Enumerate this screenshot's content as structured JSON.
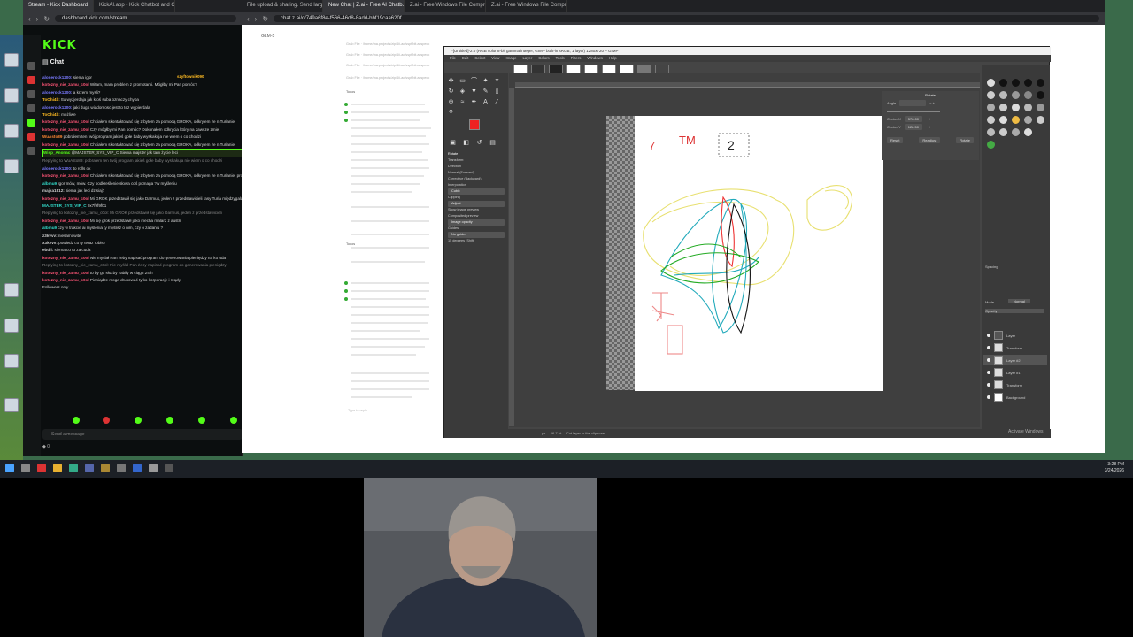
{
  "left_browser": {
    "tabs": [
      "Stream - Kick Dashboard",
      "KickAI.app - Kick Chatbot and Overl..."
    ],
    "url": "dashboard.kick.com/stream",
    "logo": "KICK",
    "chat_title": "Chat",
    "pinned_user": "szyftownik090",
    "chat_lines": [
      {
        "user": "alonerock1200:",
        "text": "siema igor",
        "color": "#7a7aff"
      },
      {
        "user": "kotozny_nie_zamu_c0ol",
        "text": "Witam, mam problem z promptami. Mógłby mi Pan pomóc?",
        "color": "#ff5577"
      },
      {
        "user": "alonerock1200:",
        "text": "a krzem mysli?",
        "color": "#7a7aff"
      },
      {
        "user": "ToOhi4b:",
        "text": "ttu wyzjerdaja jak ktoś suba oznaczy chyba",
        "color": "#ffbb22"
      },
      {
        "user": "alonerock1200:",
        "text": "jaki duga wiadomosc jest to tez wypierdala",
        "color": "#7a7aff"
      },
      {
        "user": "ToOhi4b:",
        "text": "możliwe",
        "color": "#ffbb22"
      },
      {
        "user": "kotozny_nie_zamu_c0ol",
        "text": "Chciałem skontaktować się z bytem za pomocą GROKA, odkryłem że n Turianie",
        "color": "#ff5577"
      },
      {
        "user": "kotozny_nie_zamu_c0ol",
        "text": "Czy mógłby mi Pan pomóc? Dokonałem odkrycia który na zawsze zmie",
        "color": "#ff5577"
      },
      {
        "user": "WuAsto89",
        "text": "pobrałem ten twój program jakieś gołe baby wyskakuja nie wiem o co chodzi",
        "color": "#ff8833"
      },
      {
        "user": "kotozny_nie_zamu_c0ol",
        "text": "Chciałem skontaktować się z bytem za pomocą GROKA, odkryłem że n Turianie",
        "color": "#ff5577"
      },
      {
        "user": "Wisp_Anonac",
        "text": "@MAJSTER_SYS_VIP_C Siema majster jak tam życie leci",
        "color": "#53fc18",
        "highlight": true
      },
      {
        "user": "",
        "text": "Replying to WuAsto89: pobrałem ten twój program jakieś gołe baby wyskakuja nie wiem o co chodzi",
        "color": "#888888",
        "reply": true
      },
      {
        "user": "alonerock1200:",
        "text": "to rolls ok",
        "color": "#7a7aff"
      },
      {
        "user": "kotozny_nie_zamu_c0ol",
        "text": "Chciałem skontaktować się z bytem za pomocą GROKA, odkryłem że n Turianie, proszę Pana to prawdziwe",
        "color": "#ff5577"
      },
      {
        "user": "albmu9",
        "text": "Igor mów, mów. Czy podkreślenie słowa coś pomaga ?w myśleniu",
        "color": "#33ddcc"
      },
      {
        "user": "majka1812:",
        "text": "siema jak leci dzisiaj?",
        "color": "#cccccc"
      },
      {
        "user": "kotozny_nie_zamu_c0ol",
        "text": "Mi GROK przedstawił się jako Darmus, jeden z przedstawicieli rasy Turia międzygalaktycznej. Proszę mi uwierzyć i się go zapytać",
        "color": "#ff5577"
      },
      {
        "user": "MAJSTER_SYS_VIP_C",
        "text": "0x7f9f9f01",
        "color": "#33ddcc"
      },
      {
        "user": "",
        "text": "Replying to kotozny_nie_zamu_c0ol: Mi GROK przedstawił się jako Darmus, jeden z przedstawicieli",
        "color": "#888888",
        "reply": true
      },
      {
        "user": "kotozny_nie_zamu_c0ol",
        "text": "Mi się grok przedstawił jako mecha malarz z austrii",
        "color": "#ff5577"
      },
      {
        "user": "albmu9",
        "text": "czy w trakcie ai myślenia ty myślisz o nim, czy o zadaniu ?",
        "color": "#33ddcc"
      },
      {
        "user": "z3kvvv:",
        "text": "niesamowite",
        "color": "#cccccc"
      },
      {
        "user": "x3kvvv:",
        "text": "powiedz co ty teraz robisz",
        "color": "#cccccc"
      },
      {
        "user": "ebdll:",
        "text": "siema co to za cuda",
        "color": "#cccccc"
      },
      {
        "user": "kotozny_nie_zamu_c0ol",
        "text": "Nie myślał Pan żeby napisać program do generowania pieniędzy na ko uda",
        "color": "#ff5577"
      },
      {
        "user": "",
        "text": "Replying to kotozny_nie_zamu_c0ol: Nie myślał Pan żeby napisać program do generowania pieniędzy",
        "color": "#888888",
        "reply": true
      },
      {
        "user": "kotozny_nie_zamu_c0ol",
        "text": "to by go służby zabiły w ciągu 24 h",
        "color": "#ff5577"
      },
      {
        "user": "kotozny_nie_zamu_c0ol",
        "text": "Pieniądze mogą drukować tylko korporacje i rządy",
        "color": "#ff5577"
      },
      {
        "user": "",
        "text": "Followers only",
        "color": "#aaaaaa"
      }
    ],
    "chat_input_placeholder": "Send a message",
    "chat_points": "0"
  },
  "right_browser": {
    "tabs": [
      "File upload & sharing. Send large ph...",
      "New Chat | Z.ai - Free AI Chatb...",
      "Z.ai - Free Windows File Compre...",
      "Z.ai - Free Windows File Compre..."
    ],
    "url": "chat.z.ai/c/749a6f8e-f566-46d8-8add-bbf19caa620f",
    "app_title": "GLM-5",
    "file_lines": [
      "Grab File · /home/ma.projects/zip/6ii-ac/sspt/bit.acspeck",
      "Grab File · /home/ma.projects/zip/6ii-ac/sspt/bit.acspeck",
      "Grab File · /home/ma.projects/zip/6ii-ac/sspt/bit.acspeck",
      "Grab File · /home/ma.projects/zip/6ii-ac/sspt/bit.acspeck"
    ],
    "todo_label": "Todos",
    "todo_label_2": "Todos",
    "bottom_input": "Type to reply..."
  },
  "gimp": {
    "title": "*[Untitled]-2.0 (RGB color 8-bit gamma integer, GIMP built-in sRGB, 1 layer) 1280x720 – GIMP",
    "menu": [
      "File",
      "Edit",
      "Select",
      "View",
      "Image",
      "Layer",
      "Colors",
      "Tools",
      "Filters",
      "Windows",
      "Help"
    ],
    "tool_options": {
      "title": "Rotate",
      "transform": "Transform:",
      "direction": "Direction",
      "dir_normal": "Normal (Forward)",
      "dir_corrective": "Corrective (Backward)",
      "interpolation": "Interpolation",
      "interpolation_value": "Cubic",
      "clipping": "Clipping",
      "clipping_value": "Adjust",
      "show_preview": "Show image preview",
      "composited_preview": "Composited preview",
      "image_opacity": "Image opacity",
      "guides": "Guides",
      "guides_value": "No guides",
      "angle": "15 degrees (Shift)"
    },
    "rotate_dialog": {
      "title": "Rotate",
      "angle_label": "Angle",
      "center_x_label": "Center X",
      "center_x": "578.00",
      "center_y_label": "Center Y",
      "center_y": "128.50",
      "reset": "Reset",
      "readjust": "Readjust",
      "rotate": "Rotate"
    },
    "canvas_labels": {
      "seven": "7",
      "tm": "TM",
      "two": "2"
    },
    "status": {
      "unit": "px",
      "zoom": "66.7 %",
      "message": "Cut layer to the clipboard."
    },
    "dock": {
      "spacing_label": "Spacing",
      "mode_label": "Mode",
      "mode_value": "Normal",
      "opacity_label": "Opacity",
      "layers": [
        "Layer",
        "Transform",
        "Layer #2",
        "Layer #1",
        "Transform",
        "Background"
      ]
    },
    "watermark": "Activate Windows"
  },
  "taskbar": {
    "time": "3:28 PM",
    "date": "3/24/2026"
  }
}
